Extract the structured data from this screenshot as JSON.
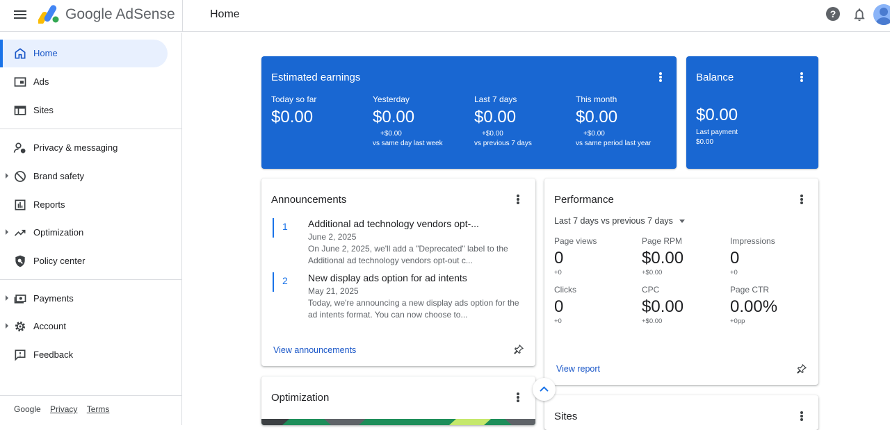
{
  "header": {
    "brand": "Google AdSense",
    "page_title": "Home",
    "help_glyph": "?"
  },
  "sidebar": {
    "items": [
      {
        "label": "Home",
        "icon": "home-icon"
      },
      {
        "label": "Ads",
        "icon": "ads-icon"
      },
      {
        "label": "Sites",
        "icon": "sites-icon"
      },
      {
        "label": "Privacy & messaging",
        "icon": "privacy-icon"
      },
      {
        "label": "Brand safety",
        "icon": "block-icon"
      },
      {
        "label": "Reports",
        "icon": "reports-icon"
      },
      {
        "label": "Optimization",
        "icon": "trending-icon"
      },
      {
        "label": "Policy center",
        "icon": "policy-icon"
      },
      {
        "label": "Payments",
        "icon": "payments-icon"
      },
      {
        "label": "Account",
        "icon": "gear-icon"
      },
      {
        "label": "Feedback",
        "icon": "feedback-icon"
      }
    ],
    "footer": {
      "google": "Google",
      "privacy": "Privacy",
      "terms": "Terms"
    }
  },
  "earnings": {
    "title": "Estimated earnings",
    "cols": [
      {
        "label": "Today so far",
        "value": "$0.00",
        "delta": "",
        "compare": ""
      },
      {
        "label": "Yesterday",
        "value": "$0.00",
        "delta": "+$0.00",
        "compare": "vs same day last week"
      },
      {
        "label": "Last 7 days",
        "value": "$0.00",
        "delta": "+$0.00",
        "compare": "vs previous 7 days"
      },
      {
        "label": "This month",
        "value": "$0.00",
        "delta": "+$0.00",
        "compare": "vs same period last year"
      }
    ]
  },
  "balance": {
    "title": "Balance",
    "value": "$0.00",
    "last_payment_label": "Last payment",
    "last_payment_value": "$0.00"
  },
  "announcements": {
    "title": "Announcements",
    "items": [
      {
        "num": "1",
        "headline": "Additional ad technology vendors opt-...",
        "date": "June 2, 2025",
        "body": "On June 2, 2025, we'll add a \"Deprecated\" label to the Additional ad technology vendors opt-out c..."
      },
      {
        "num": "2",
        "headline": "New display ads option for ad intents",
        "date": "May 21, 2025",
        "body": "Today, we're announcing a new display ads option for the ad intents format. You can now choose to..."
      }
    ],
    "link": "View announcements"
  },
  "performance": {
    "title": "Performance",
    "range": "Last 7 days vs previous 7 days",
    "metrics": [
      {
        "label": "Page views",
        "value": "0",
        "delta": "+0"
      },
      {
        "label": "Page RPM",
        "value": "$0.00",
        "delta": "+$0.00"
      },
      {
        "label": "Impressions",
        "value": "0",
        "delta": "+0"
      },
      {
        "label": "Clicks",
        "value": "0",
        "delta": "+0"
      },
      {
        "label": "CPC",
        "value": "$0.00",
        "delta": "+$0.00"
      },
      {
        "label": "Page CTR",
        "value": "0.00%",
        "delta": "+0pp"
      }
    ],
    "link": "View report"
  },
  "optimization": {
    "title": "Optimization"
  },
  "sites": {
    "title": "Sites"
  },
  "colors": {
    "primary": "#1967d2",
    "accent": "#1a73e8",
    "nav_active_bg": "#e8f0fe"
  }
}
